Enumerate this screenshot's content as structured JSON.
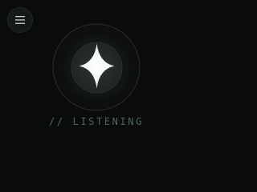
{
  "menu": {
    "icon": "hamburger-menu-icon"
  },
  "orb": {
    "icon": "sparkle-star-icon",
    "accent": "#e8eeee"
  },
  "status": {
    "prefix": "//",
    "label": "LISTENING",
    "color": "#4f6664"
  }
}
